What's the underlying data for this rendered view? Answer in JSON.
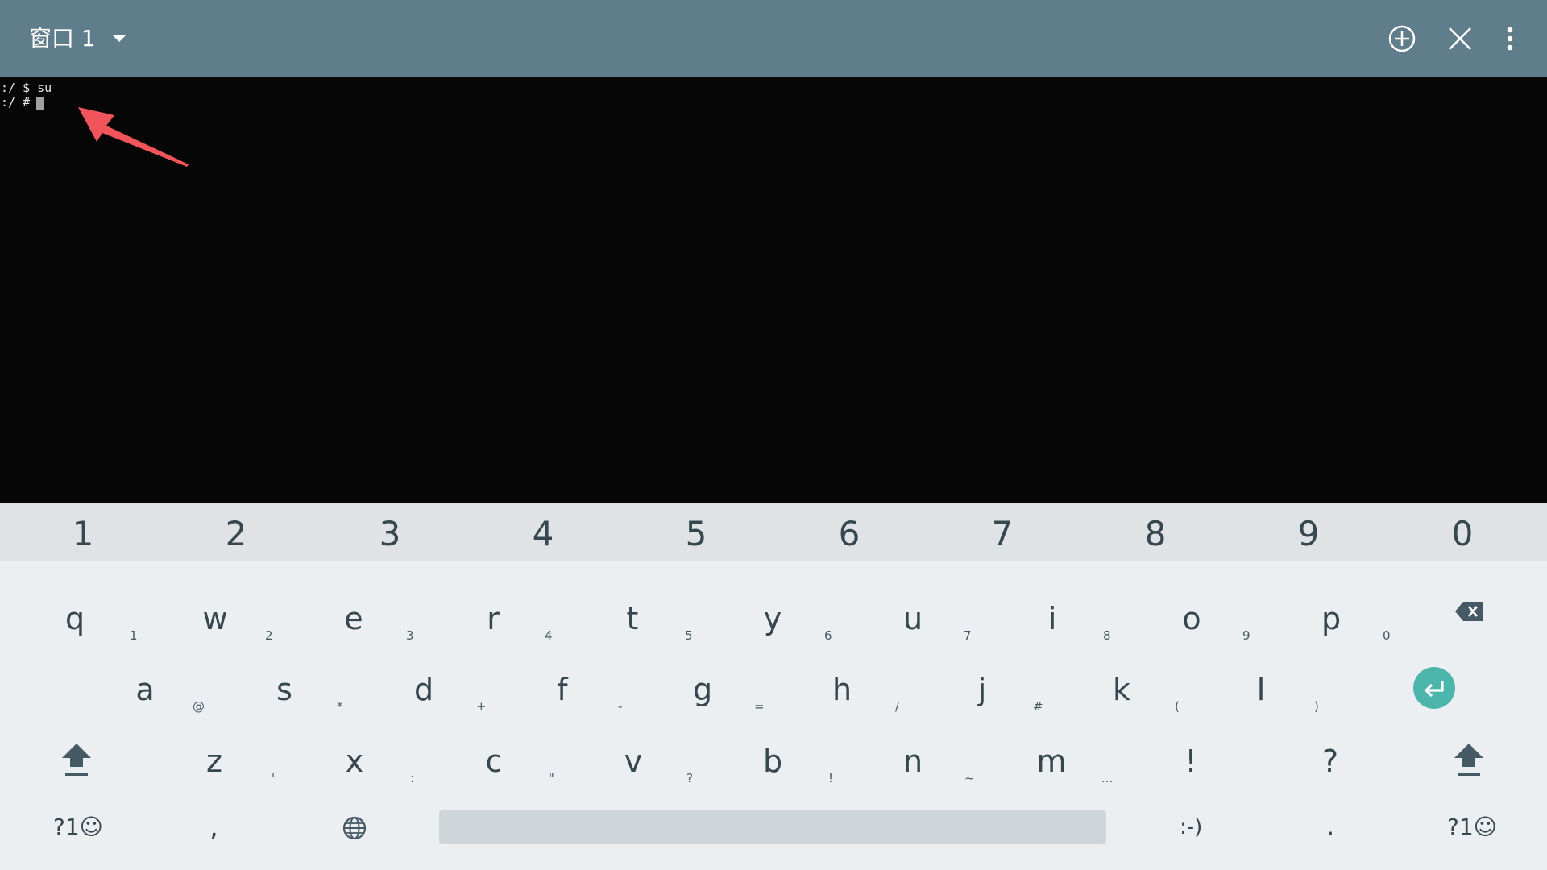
{
  "titlebar": {
    "window_title": "窗口 1",
    "icons": [
      "chevron-down-icon",
      "add-window-icon",
      "close-icon",
      "overflow-menu-icon"
    ],
    "background": "#607d8b"
  },
  "terminal": {
    "lines": [
      ":/ $ su",
      ":/ # "
    ],
    "background": "#060606",
    "cursor_color": "#a0a0a0"
  },
  "annotation": {
    "arrow_color": "#f2545b"
  },
  "keyboard": {
    "number_row": [
      "1",
      "2",
      "3",
      "4",
      "5",
      "6",
      "7",
      "8",
      "9",
      "0"
    ],
    "row1": [
      {
        "key": "q",
        "hint": "1"
      },
      {
        "key": "w",
        "hint": "2"
      },
      {
        "key": "e",
        "hint": "3"
      },
      {
        "key": "r",
        "hint": "4"
      },
      {
        "key": "t",
        "hint": "5"
      },
      {
        "key": "y",
        "hint": "6"
      },
      {
        "key": "u",
        "hint": "7"
      },
      {
        "key": "i",
        "hint": "8"
      },
      {
        "key": "o",
        "hint": "9"
      },
      {
        "key": "p",
        "hint": "0"
      }
    ],
    "row2": [
      {
        "key": "a",
        "hint": "@"
      },
      {
        "key": "s",
        "hint": "*"
      },
      {
        "key": "d",
        "hint": "+"
      },
      {
        "key": "f",
        "hint": "-"
      },
      {
        "key": "g",
        "hint": "="
      },
      {
        "key": "h",
        "hint": "/"
      },
      {
        "key": "j",
        "hint": "#"
      },
      {
        "key": "k",
        "hint": "("
      },
      {
        "key": "l",
        "hint": ")"
      }
    ],
    "row3": [
      {
        "key": "z",
        "hint": "'"
      },
      {
        "key": "x",
        "hint": ":"
      },
      {
        "key": "c",
        "hint": "\""
      },
      {
        "key": "v",
        "hint": "?"
      },
      {
        "key": "b",
        "hint": "!"
      },
      {
        "key": "n",
        "hint": "~"
      },
      {
        "key": "m",
        "hint": "..."
      },
      {
        "key": "!",
        "hint": ""
      },
      {
        "key": "?",
        "hint": ""
      }
    ],
    "bottom": {
      "symbols_left": "?1☺",
      "comma": ",",
      "emoticon": ":-)",
      "period": ".",
      "symbols_right": "?1☺"
    },
    "enter_color": "#4db6ac",
    "background": "#eceff1",
    "number_row_background": "#e0e3e5"
  }
}
